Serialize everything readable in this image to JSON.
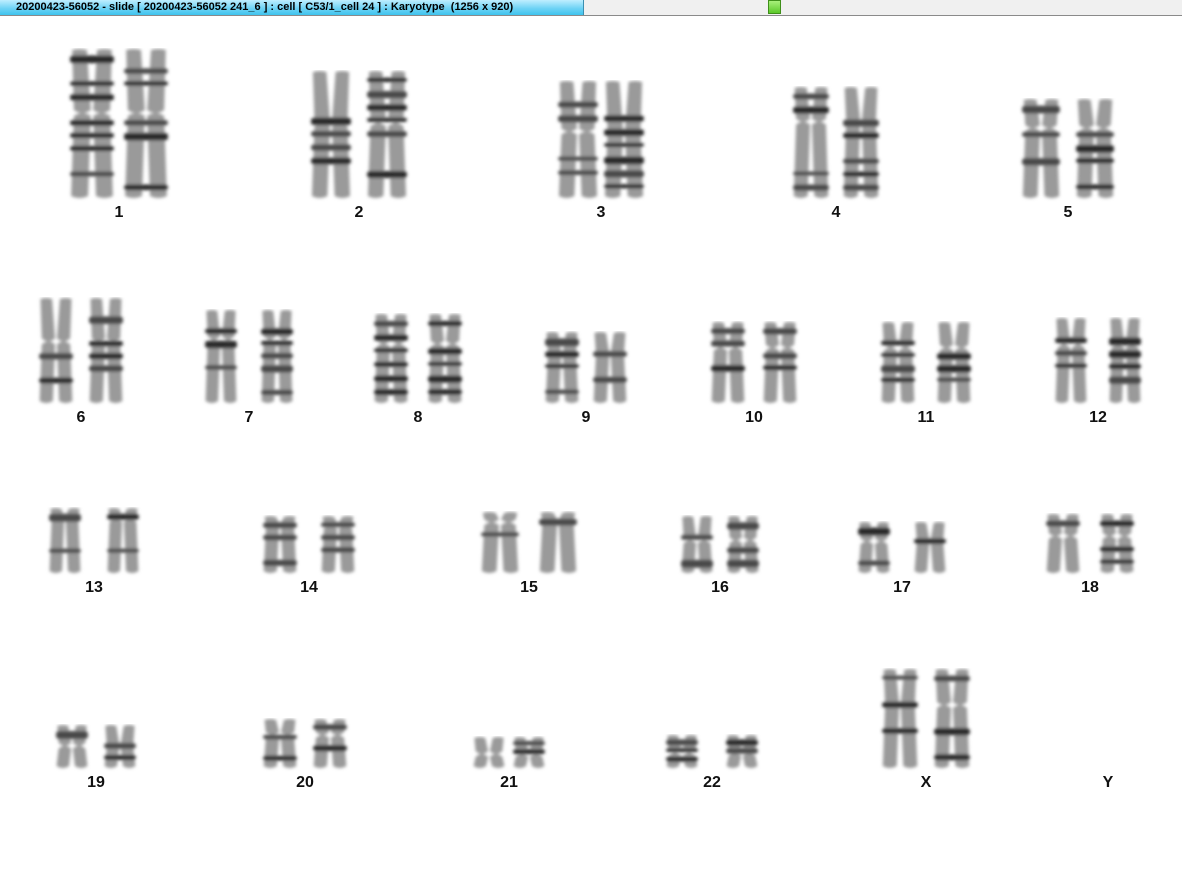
{
  "window": {
    "title": "20200423-56052 - slide [ 20200423-56052 241_6 ] : cell [ C53/1_cell 24 ] : Karyotype  (1256 x 920)"
  },
  "karyotype": {
    "chromosomes": [
      {
        "label": "1",
        "present": true
      },
      {
        "label": "2",
        "present": true
      },
      {
        "label": "3",
        "present": true
      },
      {
        "label": "4",
        "present": true
      },
      {
        "label": "5",
        "present": true
      },
      {
        "label": "6",
        "present": true
      },
      {
        "label": "7",
        "present": true
      },
      {
        "label": "8",
        "present": true
      },
      {
        "label": "9",
        "present": true
      },
      {
        "label": "10",
        "present": true
      },
      {
        "label": "11",
        "present": true
      },
      {
        "label": "12",
        "present": true
      },
      {
        "label": "13",
        "present": true
      },
      {
        "label": "14",
        "present": true
      },
      {
        "label": "15",
        "present": true
      },
      {
        "label": "16",
        "present": true
      },
      {
        "label": "17",
        "present": true
      },
      {
        "label": "18",
        "present": true
      },
      {
        "label": "19",
        "present": true
      },
      {
        "label": "20",
        "present": true
      },
      {
        "label": "21",
        "present": true
      },
      {
        "label": "22",
        "present": true
      },
      {
        "label": "X",
        "present": true
      },
      {
        "label": "Y",
        "present": false
      }
    ]
  }
}
